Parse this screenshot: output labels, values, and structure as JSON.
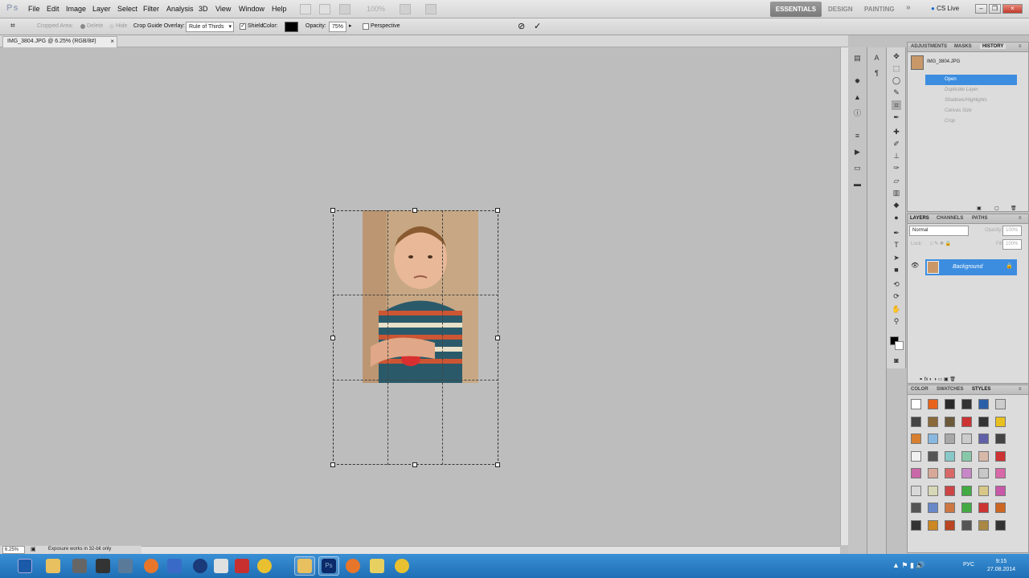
{
  "app": {
    "logo": "Ps"
  },
  "menu": [
    "File",
    "Edit",
    "Image",
    "Layer",
    "Select",
    "Filter",
    "Analysis",
    "3D",
    "View",
    "Window",
    "Help"
  ],
  "menubar_zoom": "100%",
  "workspaces": {
    "active": "ESSENTIALS",
    "design": "DESIGN",
    "painting": "PAINTING",
    "more": "»"
  },
  "cs_live": "CS Live",
  "options": {
    "cropped_area": "Cropped Area:",
    "delete": "Delete",
    "hide": "Hide",
    "guide_overlay_label": "Crop Guide Overlay:",
    "guide_overlay_value": "Rule of Thirds",
    "shield": "Shield",
    "color_label": "Color:",
    "opacity_label": "Opacity:",
    "opacity_value": "75%",
    "perspective": "Perspective",
    "cancel_icon": "cancel-icon",
    "commit_icon": "commit-icon",
    "shield_color": "#000000"
  },
  "document": {
    "tab_title": "IMG_3804.JPG @ 6.25% (RGB/8#)",
    "close": "×"
  },
  "status": {
    "zoom": "6.25%",
    "text": "Exposure works in 32-bit only"
  },
  "history_panel": {
    "tabs": [
      "ADJUSTMENTS",
      "MASKS",
      "HISTORY"
    ],
    "snapshot": "IMG_3804.JPG",
    "items": [
      "Open",
      "Duplicate Layer",
      "Shadows/Highlights",
      "Canvas Size",
      "Crop"
    ]
  },
  "layers_panel": {
    "tabs": [
      "LAYERS",
      "CHANNELS",
      "PATHS"
    ],
    "blend_mode": "Normal",
    "opacity_label": "Opacity:",
    "opacity_value": "100%",
    "lock_label": "Lock:",
    "fill_label": "Fill:",
    "fill_value": "100%",
    "layer_name": "Background"
  },
  "styles_panel": {
    "tabs": [
      "COLOR",
      "SWATCHES",
      "STYLES"
    ],
    "swatches": [
      "#ffffff",
      "#e8641c",
      "#2a2a2a",
      "#333333",
      "#2a5fa8",
      "#cccccc",
      "#444444",
      "#8a6a3a",
      "#6a5a3a",
      "#cc3333",
      "#333333",
      "#e8c020",
      "#d88030",
      "#88b8e0",
      "#a8a8a8",
      "#cccccc",
      "#6060a8",
      "#444444",
      "#f0f0f0",
      "#555555",
      "#88c8c8",
      "#88c8a8",
      "#d8b8a8",
      "#cc3333",
      "#c868a8",
      "#d8a898",
      "#d86868",
      "#c888c8",
      "#c8c8c8",
      "#d868a8",
      "#d8d8d8",
      "#d8d8b8",
      "#cc4444",
      "#44aa44",
      "#d8c888",
      "#c858a8",
      "#555555",
      "#6888c8",
      "#cc7744",
      "#44aa44",
      "#cc3333",
      "#cc6622",
      "#333333",
      "#cc8822",
      "#bb4422",
      "#555555",
      "#aa8844",
      "#333333"
    ]
  },
  "taskbar": {
    "lang": "РУС",
    "time": "9:15",
    "date": "27.08.2014"
  }
}
